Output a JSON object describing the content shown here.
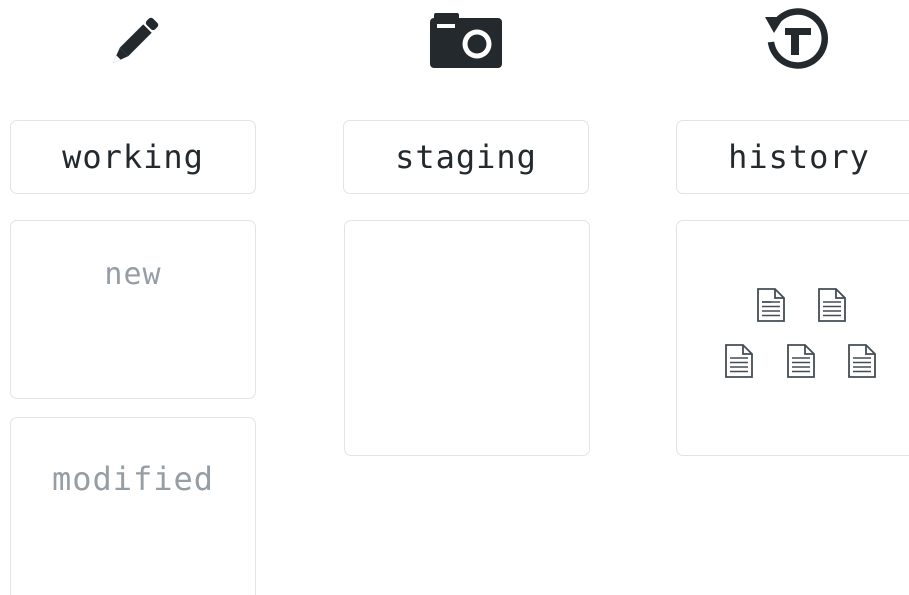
{
  "columns": {
    "working": {
      "icon": "pencil-icon",
      "label": "working",
      "areas": {
        "new": "new",
        "modified": "modified"
      }
    },
    "staging": {
      "icon": "camera-icon",
      "label": "staging"
    },
    "history": {
      "icon": "history-icon",
      "label": "history",
      "file_icon": "document-icon",
      "file_count": 5
    }
  },
  "colors": {
    "ink": "#24292e",
    "muted_text": "#959da5",
    "border": "#e1e4e8"
  }
}
